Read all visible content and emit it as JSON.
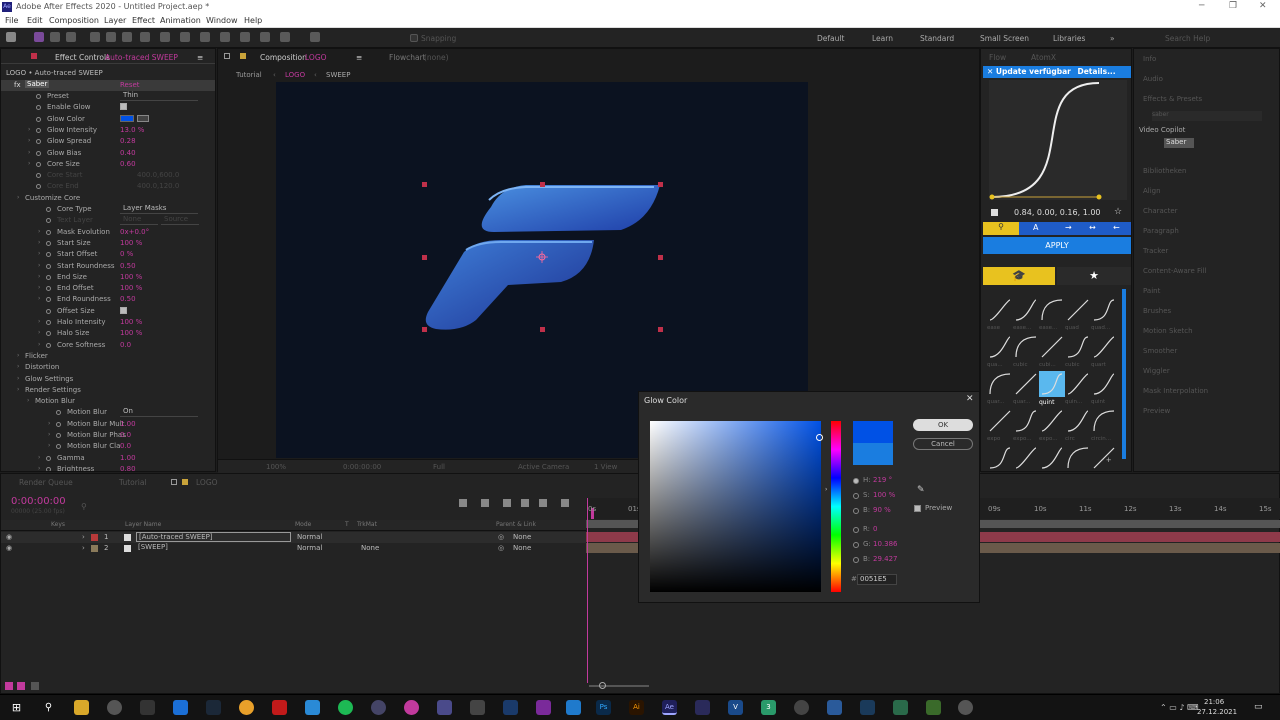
{
  "app": {
    "title": "Adobe After Effects 2020 - Untitled Project.aep *",
    "logo": "Ae",
    "win_min": "─",
    "win_max": "❐",
    "win_close": "✕"
  },
  "menu": [
    "File",
    "Edit",
    "Composition",
    "Layer",
    "Effect",
    "Animation",
    "Window",
    "Help"
  ],
  "toolbar": {
    "snapping": "Snapping",
    "workspaces": [
      "Default",
      "Learn",
      "Standard",
      "Small Screen",
      "Libraries"
    ],
    "more": "»",
    "search": "Search Help"
  },
  "effect_controls": {
    "tab": "Effect Controls",
    "tab_layer": "Auto-traced SWEEP",
    "menu": "≡",
    "breadcrumb": "LOGO • Auto-traced SWEEP",
    "effect_name": "Saber",
    "reset": "Reset",
    "rows": [
      {
        "label": "Preset",
        "kind": "dd",
        "value": "Thin"
      },
      {
        "label": "Enable Glow",
        "kind": "cb"
      },
      {
        "label": "Glow Color",
        "kind": "color"
      },
      {
        "label": "Glow Intensity",
        "kind": "num",
        "value": "13.0 %",
        "tw": true
      },
      {
        "label": "Glow Spread",
        "kind": "num",
        "value": "0.28",
        "tw": true
      },
      {
        "label": "Glow Bias",
        "kind": "num",
        "value": "0.40",
        "tw": true
      },
      {
        "label": "Core Size",
        "kind": "num",
        "value": "0.60",
        "tw": true
      },
      {
        "label": "Core Start",
        "kind": "dim",
        "value": "400.0,600.0"
      },
      {
        "label": "Core End",
        "kind": "dim",
        "value": "400.0,120.0"
      },
      {
        "label": "Customize Core",
        "kind": "group"
      },
      {
        "label": "Core Type",
        "kind": "dd",
        "value": "Layer Masks",
        "ind": 1
      },
      {
        "label": "Text Layer",
        "kind": "dimdd",
        "value": "None",
        "value2": "Source",
        "ind": 1
      },
      {
        "label": "Mask Evolution",
        "kind": "num",
        "value": "0x+0.0°",
        "ind": 1,
        "tw": true
      },
      {
        "label": "Start Size",
        "kind": "num",
        "value": "100 %",
        "ind": 1,
        "tw": true
      },
      {
        "label": "Start Offset",
        "kind": "num",
        "value": "0 %",
        "ind": 1,
        "tw": true
      },
      {
        "label": "Start Roundness",
        "kind": "num",
        "value": "0.50",
        "ind": 1,
        "tw": true
      },
      {
        "label": "End Size",
        "kind": "num",
        "value": "100 %",
        "ind": 1,
        "tw": true
      },
      {
        "label": "End Offset",
        "kind": "num",
        "value": "100 %",
        "ind": 1,
        "tw": true
      },
      {
        "label": "End Roundness",
        "kind": "num",
        "value": "0.50",
        "ind": 1,
        "tw": true
      },
      {
        "label": "Offset Size",
        "kind": "cb",
        "ind": 1
      },
      {
        "label": "Halo Intensity",
        "kind": "num",
        "value": "100 %",
        "ind": 1,
        "tw": true
      },
      {
        "label": "Halo Size",
        "kind": "num",
        "value": "100 %",
        "ind": 1,
        "tw": true
      },
      {
        "label": "Core Softness",
        "kind": "num",
        "value": "0.0",
        "ind": 1,
        "tw": true
      },
      {
        "label": "Flicker",
        "kind": "group"
      },
      {
        "label": "Distortion",
        "kind": "group"
      },
      {
        "label": "Glow Settings",
        "kind": "group"
      },
      {
        "label": "Render Settings",
        "kind": "group"
      },
      {
        "label": "Motion Blur",
        "kind": "group",
        "ind": 1
      },
      {
        "label": "Motion Blur",
        "kind": "dd",
        "value": "On",
        "ind": 2
      },
      {
        "label": "Motion Blur Mult",
        "kind": "num",
        "value": "1.00",
        "ind": 2,
        "tw": true
      },
      {
        "label": "Motion Blur Phas",
        "kind": "num",
        "value": "0.0",
        "ind": 2,
        "tw": true
      },
      {
        "label": "Motion Blur Cla",
        "kind": "num",
        "value": "0.0",
        "ind": 2,
        "tw": true
      },
      {
        "label": "Gamma",
        "kind": "num",
        "value": "1.00",
        "ind": 1,
        "tw": true
      },
      {
        "label": "Brightness",
        "kind": "num",
        "value": "0.80",
        "ind": 1,
        "tw": true
      }
    ]
  },
  "composition": {
    "tab": "Composition",
    "tab_name": "LOGO",
    "menu": "≡",
    "flowchart": "Flowchart",
    "flowchart_val": "(none)",
    "crumbs": [
      "Tutorial",
      "LOGO",
      "SWEEP"
    ],
    "viewer_bar": {
      "zoom": "100%",
      "time": "0:00:00:00",
      "res": "Full",
      "camera": "Active Camera",
      "views": "1 View"
    }
  },
  "right_mid": {
    "tabs": [
      "Flow",
      "AtomX"
    ],
    "update": "Update verfügbar",
    "details": "Details...",
    "bezier": "0.84, 0.00, 0.16, 1.00",
    "apply": "APPLY",
    "ease_labels": [
      "ease",
      "ease...",
      "ease...",
      "quad",
      "quad...",
      "qua...",
      "cubic",
      "cubi...",
      "cubic",
      "quart",
      "quar...",
      "quar...",
      "quint",
      "quin...",
      "quint",
      "expo",
      "expo...",
      "expo...",
      "circ",
      "circin...",
      "circ...",
      "back",
      "back...",
      "back...",
      "line..."
    ]
  },
  "right_panel": {
    "items": [
      "Info",
      "Audio",
      "Effects & Presets",
      "Video Copilot",
      "Saber",
      "Bibliotheken",
      "Align",
      "Character",
      "Paragraph",
      "Tracker",
      "Content-Aware Fill",
      "Paint",
      "Brushes",
      "Motion Sketch",
      "Smoother",
      "Wiggler",
      "Mask Interpolation",
      "Preview"
    ],
    "search": "saber"
  },
  "timeline": {
    "tabs": [
      "Render Queue",
      "Tutorial",
      "LOGO"
    ],
    "time": "0:00:00:00",
    "frames": "00000 (25.00 fps)",
    "headers": {
      "keys": "Keys",
      "layer": "Layer Name",
      "mode": "Mode",
      "t": "T",
      "trkmat": "TrkMat",
      "parent": "Parent & Link"
    },
    "layers": [
      {
        "num": "1",
        "name": "[Auto-traced SWEEP]",
        "mode": "Normal",
        "trk": "",
        "parent": "None",
        "color": "#b83a3a"
      },
      {
        "num": "2",
        "name": "[SWEEP]",
        "mode": "Normal",
        "trk": "None",
        "parent": "None",
        "color": "#8a7a5a"
      }
    ],
    "ruler": [
      "0s",
      "01s",
      "09s",
      "10s",
      "11s",
      "12s",
      "13s",
      "14s",
      "15s"
    ]
  },
  "glow_dialog": {
    "title": "Glow Color",
    "close": "✕",
    "ok": "OK",
    "cancel": "Cancel",
    "h_lab": "H:",
    "h": "219 °",
    "s_lab": "S:",
    "s": "100 %",
    "b_lab": "B:",
    "b": "90 %",
    "r_lab": "R:",
    "r": "0",
    "g_lab": "G:",
    "g": "10.386",
    "bl_lab": "B:",
    "bl": "29.427",
    "hex_lab": "#",
    "hex": "0051E5",
    "preview": "Preview",
    "new_color": "#0051e5",
    "old_color": "#1a7de0"
  },
  "taskbar": {
    "time": "21:06",
    "date": "27.12.2021"
  }
}
